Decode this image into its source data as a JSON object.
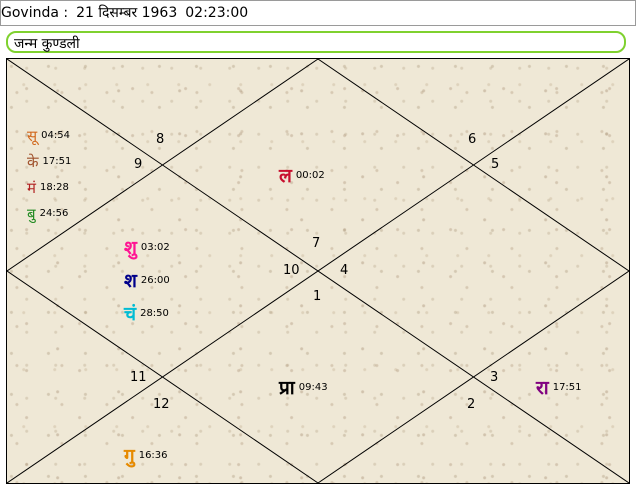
{
  "header": {
    "name": "Govinda :",
    "date": "21 दिसम्बर 1963",
    "time": "02:23:00"
  },
  "chart_title": "जन्म कुण्डली",
  "houses": {
    "h1": "1",
    "h2": "2",
    "h3": "3",
    "h4": "4",
    "h5": "5",
    "h6": "6",
    "h7": "7",
    "h8": "8",
    "h9": "9",
    "h10": "10",
    "h11": "11",
    "h12": "12"
  },
  "planets": {
    "surya": {
      "abbr": "सू",
      "degree": "04:54",
      "color": "#d2691e"
    },
    "ketu": {
      "abbr": "के",
      "degree": "17:51",
      "color": "#a0522d"
    },
    "mangal": {
      "abbr": "मं",
      "degree": "18:28",
      "color": "#b22222"
    },
    "budh": {
      "abbr": "बु",
      "degree": "24:56",
      "color": "#228b22"
    },
    "lagna": {
      "abbr": "ल",
      "degree": "00:02",
      "color": "#c8102e"
    },
    "shukra": {
      "abbr": "शु",
      "degree": "03:02",
      "color": "#ff1493"
    },
    "shani": {
      "abbr": "श",
      "degree": "26:00",
      "color": "#00008b"
    },
    "chandra": {
      "abbr": "चं",
      "degree": "28:50",
      "color": "#00bcd4"
    },
    "pranapada": {
      "abbr": "प्रा",
      "degree": "09:43",
      "color": "#000000"
    },
    "rahu": {
      "abbr": "रा",
      "degree": "17:51",
      "color": "#800080"
    },
    "guru": {
      "abbr": "गु",
      "degree": "16:36",
      "color": "#e68a00"
    }
  }
}
